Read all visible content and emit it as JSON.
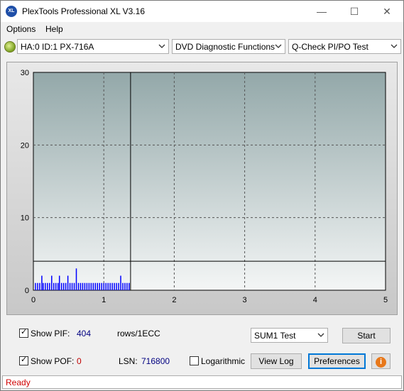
{
  "window": {
    "title": "PlexTools Professional XL V3.16",
    "logo_text": "XL",
    "minimize_glyph": "—",
    "maximize_glyph": "☐",
    "close_glyph": "✕"
  },
  "menu": {
    "items": [
      {
        "label": "Options"
      },
      {
        "label": "Help"
      }
    ]
  },
  "toolbar": {
    "drive": "HA:0 ID:1  PX-716A",
    "function": "DVD Diagnostic Functions",
    "test": "Q-Check PI/PO Test"
  },
  "chart_data": {
    "type": "bar",
    "xlim": [
      0,
      5
    ],
    "ylim": [
      0,
      30
    ],
    "x_ticks": [
      "0",
      "1",
      "2",
      "3",
      "4",
      "5"
    ],
    "y_ticks": [
      "0",
      "10",
      "20",
      "30"
    ],
    "grid": true,
    "threshold_line": 4,
    "progress_x": 1.38,
    "series": [
      {
        "color": "#0000ff",
        "x": [
          0.03,
          0.06,
          0.09,
          0.12,
          0.14,
          0.17,
          0.2,
          0.23,
          0.26,
          0.29,
          0.32,
          0.35,
          0.37,
          0.4,
          0.43,
          0.46,
          0.49,
          0.52,
          0.55,
          0.58,
          0.61,
          0.64,
          0.67,
          0.7,
          0.73,
          0.76,
          0.79,
          0.82,
          0.85,
          0.88,
          0.91,
          0.94,
          0.97,
          1.0,
          1.03,
          1.06,
          1.09,
          1.12,
          1.15,
          1.18,
          1.21,
          1.24,
          1.27,
          1.3,
          1.33,
          1.36
        ],
        "values": [
          1,
          1,
          1,
          2,
          1,
          1,
          1,
          1,
          2,
          1,
          1,
          1,
          2,
          1,
          1,
          1,
          2,
          1,
          1,
          1,
          3,
          1,
          1,
          1,
          1,
          1,
          1,
          1,
          1,
          1,
          1,
          1,
          1,
          1,
          1,
          1,
          1,
          1,
          1,
          1,
          1,
          2,
          1,
          1,
          1,
          1
        ]
      }
    ]
  },
  "controls": {
    "show_pif_label": "Show PIF:",
    "pif_value": "404",
    "rows_label": "rows/1ECC",
    "show_pof_label": "Show POF:",
    "pof_value": "0",
    "lsn_label": "LSN:",
    "lsn_value": "716800",
    "logarithmic_label": "Logarithmic",
    "sum_test": "SUM1 Test",
    "start_label": "Start",
    "view_log_label": "View Log",
    "preferences_label": "Preferences",
    "info_glyph": "i"
  },
  "status": {
    "text": "Ready"
  },
  "colors": {
    "pif_value": "#000080",
    "pof_value": "#c00000",
    "status": "#d00000",
    "bars": "#0000ff"
  }
}
